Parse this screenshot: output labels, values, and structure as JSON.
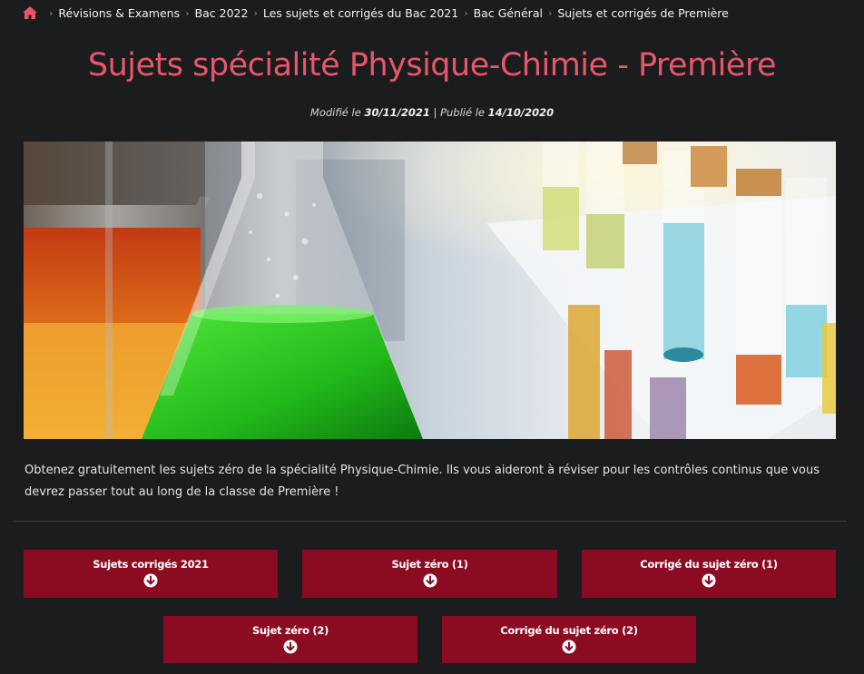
{
  "breadcrumb": {
    "home_icon": "home-icon",
    "items": [
      "Révisions & Examens",
      "Bac 2022",
      "Les sujets et corrigés du Bac 2021",
      "Bac Général",
      "Sujets et corrigés de Première"
    ],
    "separator": "›"
  },
  "page": {
    "title": "Sujets spécialité Physique-Chimie - Première",
    "modified_label": "Modifié le",
    "modified_date": "30/11/2021",
    "separator": "|",
    "published_label": "Publié le",
    "published_date": "14/10/2020",
    "intro": "Obtenez gratuitement les sujets zéro de la spécialité Physique-Chimie. Ils vous aideront à réviser pour les contrôles continus que vous devrez passer tout au long de la classe de Première !"
  },
  "downloads": [
    {
      "label": "Sujets corrigés 2021",
      "icon": "download-arrow-icon"
    },
    {
      "label": "Sujet zéro (1)",
      "icon": "download-arrow-icon"
    },
    {
      "label": "Corrigé du sujet zéro (1)",
      "icon": "download-arrow-icon"
    },
    {
      "label": "Sujet zéro (2)",
      "icon": "download-arrow-icon"
    },
    {
      "label": "Corrigé du sujet zéro (2)",
      "icon": "download-arrow-icon"
    }
  ],
  "colors": {
    "background": "#1b1c1e",
    "title": "#e8566a",
    "button": "#8b0c22",
    "home_icon": "#e8566a"
  }
}
